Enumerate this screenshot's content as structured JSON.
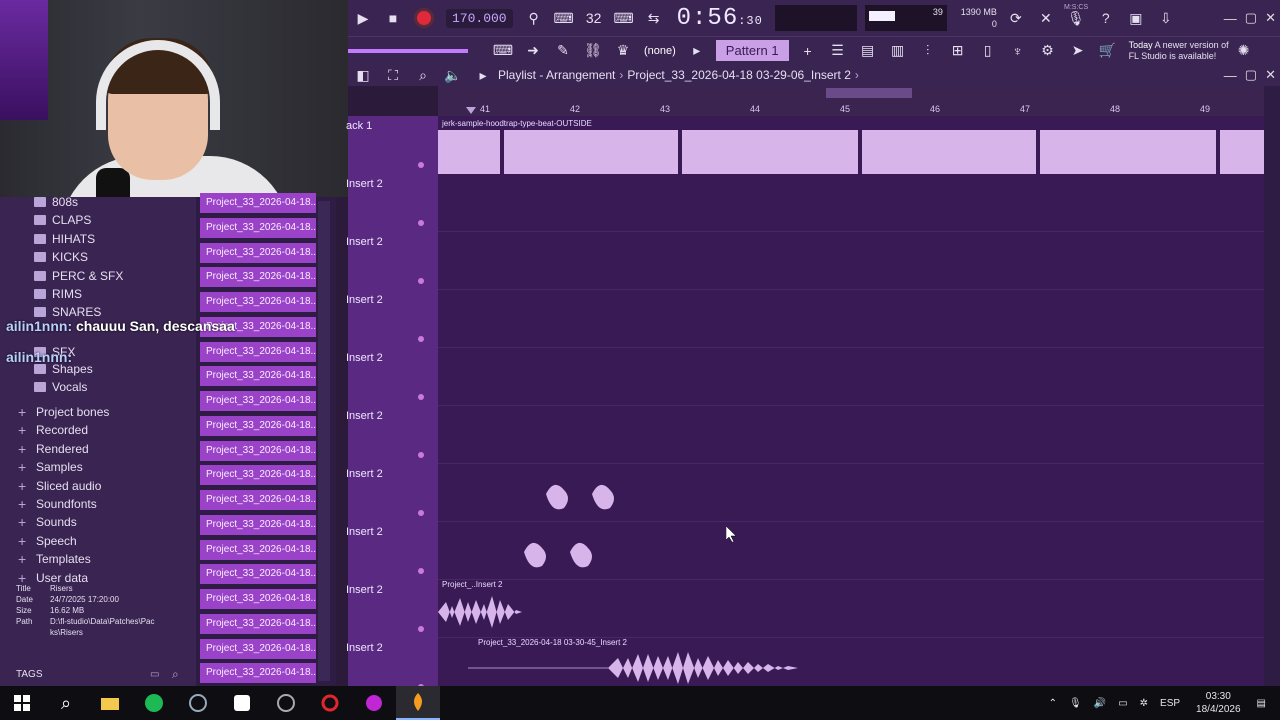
{
  "transport": {
    "tempo": "170.000",
    "time_main": "0:56",
    "time_sub": ":30",
    "time_mode": "M:S:CS",
    "cpu": "39",
    "memory": "1390 MB",
    "memory_sub": "0",
    "pattern": "Pattern 1",
    "snap": "(none)",
    "snap_num": "32"
  },
  "notice": {
    "line1_prefix": "Today",
    "line1": "A newer version of",
    "line2": "FL Studio is available!"
  },
  "playlist": {
    "title": "Playlist - Arrangement",
    "project": "Project_33_2026-04-18 03-29-06_Insert 2",
    "ruler": [
      "41",
      "42",
      "43",
      "44",
      "45",
      "46",
      "47",
      "48",
      "49"
    ],
    "tracks": [
      "ack 1",
      "Insert 2",
      "Insert 2",
      "Insert 2",
      "Insert 2",
      "Insert 2",
      "Insert 2",
      "Insert 2",
      "Insert 2",
      "Insert 2"
    ],
    "clips": {
      "main": "jerk-sample-hoodtrap-type-beat-OUTSIDE",
      "short": "Project_..Insert 2",
      "bottom": "Project_33_2026-04-18 03-30-45_Insert 2"
    }
  },
  "browser": {
    "tree": [
      "808s",
      "CLAPS",
      "HIHATS",
      "KICKS",
      "PERC & SFX",
      "RIMS",
      "SNARES",
      "SFX",
      "Shapes",
      "Vocals",
      "Project bones",
      "Recorded",
      "Rendered",
      "Samples",
      "Sliced audio",
      "Soundfonts",
      "Sounds",
      "Speech",
      "Templates",
      "User data"
    ],
    "info": {
      "title_k": "Title",
      "title_v": "Risers",
      "date_k": "Date",
      "date_v": "24/7/2025 17:20:00",
      "size_k": "Size",
      "size_v": "16.62 MB",
      "path_k": "Path",
      "path_v1": "D:\\fl-studio\\Data\\Patches\\Pac",
      "path_v2": "ks\\Risers"
    },
    "tags": "TAGS"
  },
  "projects": [
    "Project_33_2026-04-18...",
    "Project_33_2026-04-18...",
    "Project_33_2026-04-18...",
    "Project_33_2026-04-18...",
    "Project_33_2026-04-18...",
    "Project_33_2026-04-18...",
    "Project_33_2026-04-18...",
    "Project_33_2026-04-18...",
    "Project_33_2026-04-18...",
    "Project_33_2026-04-18...",
    "Project_33_2026-04-18...",
    "Project_33_2026-04-18...",
    "Project_33_2026-04-18...",
    "Project_33_2026-04-18...",
    "Project_33_2026-04-18...",
    "Project_33_2026-04-18...",
    "Project_33_2026-04-18...",
    "Project_33_2026-04-18...",
    "Project_33_2026-04-18...",
    "Project_33_2026-04-18..."
  ],
  "chat": [
    {
      "user": "ailin1nnn:",
      "msg": "chauuu San, descansaa"
    },
    {
      "user": "ailin1nnn:",
      "msg": ""
    }
  ],
  "taskbar": {
    "lang": "ESP",
    "time": "03:30",
    "date": "18/4/2026"
  },
  "colors": {
    "accent": "#9a43c8",
    "background": "#3a1a55",
    "record": "#e02a3c"
  }
}
